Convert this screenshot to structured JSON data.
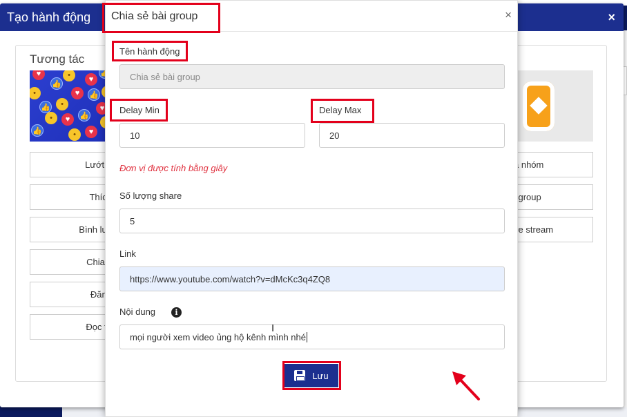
{
  "outer_modal": {
    "title": "Tạo hành động",
    "close": "×",
    "column_title": "Tương tác",
    "left_buttons": [
      "Lướt n",
      "Thích",
      "Bình luậ",
      "Chia s",
      "Đăng",
      "Đọc th"
    ],
    "right_buttons": [
      "a nhóm",
      "i group",
      "ve stream"
    ]
  },
  "inner_modal": {
    "title": "Chia sẻ bài group",
    "close": "×",
    "action_name_label": "Tên hành động",
    "action_name_value": "Chia sẻ bài group",
    "delay_min_label": "Delay Min",
    "delay_min_value": "10",
    "delay_max_label": "Delay Max",
    "delay_max_value": "20",
    "unit_hint": "Đơn vị được tính bằng giây",
    "share_count_label": "Số lượng share",
    "share_count_value": "5",
    "link_label": "Link",
    "link_value": "https://www.youtube.com/watch?v=dMcKc3q4ZQ8",
    "content_label": "Nội dung",
    "content_value": "mọi người xem video ủng hộ kênh mình nhé",
    "save_label": "Lưu"
  },
  "colors": {
    "header_blue": "#1c2f8f",
    "highlight_red": "#e3001b",
    "hint_red": "#e0303e"
  }
}
